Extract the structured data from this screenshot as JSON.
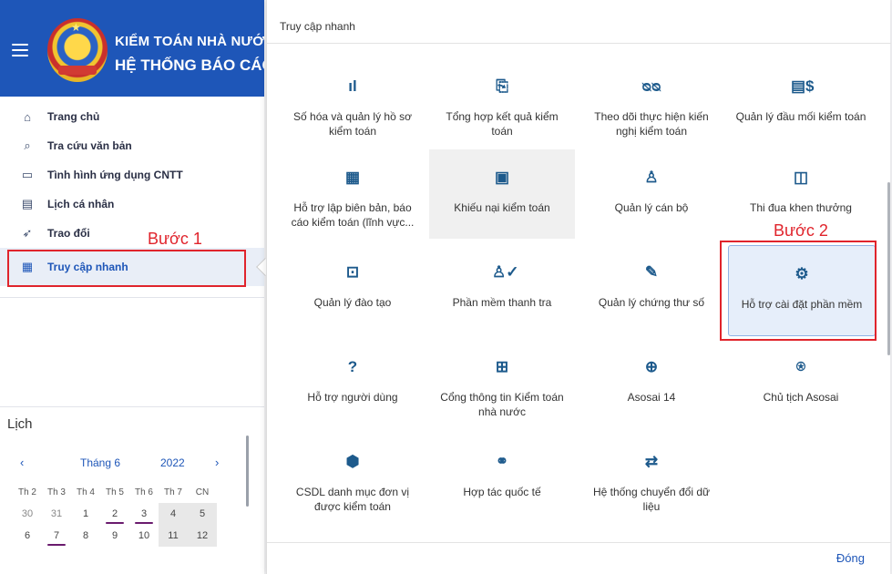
{
  "header": {
    "brand_line1": "KIỂM TOÁN NHÀ NƯỚC",
    "brand_line2": "HỆ THỐNG BÁO CÁO",
    "menu_icon": "hamburger-icon",
    "logo": "seal-logo"
  },
  "sidebar": {
    "items": [
      {
        "label": "Trang chủ",
        "icon": "home-icon"
      },
      {
        "label": "Tra cứu văn bản",
        "icon": "document-search-icon"
      },
      {
        "label": "Tình hình ứng dụng CNTT",
        "icon": "monitor-icon"
      },
      {
        "label": "Lịch cá nhân",
        "icon": "calendar-icon"
      },
      {
        "label": "Trao đổi",
        "icon": "send-icon"
      },
      {
        "label": "Truy cập nhanh",
        "icon": "quick-access-icon"
      }
    ],
    "annotation": "Bước 1"
  },
  "calendar": {
    "title": "Lịch",
    "month": "Tháng 6",
    "year": "2022",
    "weekdays": [
      "Th 2",
      "Th 3",
      "Th 4",
      "Th 5",
      "Th 6",
      "Th 7",
      "CN"
    ],
    "rows": [
      [
        "30",
        "31",
        "1",
        "2",
        "3",
        "4",
        "5"
      ],
      [
        "6",
        "7",
        "8",
        "9",
        "10",
        "11",
        "12"
      ]
    ]
  },
  "panel": {
    "title": "Truy cập nhanh",
    "close_label": "Đóng",
    "annotation": "Bước 2",
    "tiles": [
      {
        "label": "Số hóa và quản lý hồ sơ kiểm toán",
        "icon": "bar-chart-icon",
        "glyph": "ıl"
      },
      {
        "label": "Tổng hợp kết quả kiểm toán",
        "icon": "report-money-icon",
        "glyph": "⎘"
      },
      {
        "label": "Theo dõi thực hiện kiến nghị kiểm toán",
        "icon": "binoculars-icon",
        "glyph": "ᴓᴓ"
      },
      {
        "label": "Quản lý đầu mối kiểm toán",
        "icon": "building-money-icon",
        "glyph": "▤$"
      },
      {
        "label": "Hỗ trợ lập biên bản, báo cáo kiểm toán (lĩnh vực...",
        "icon": "document-chart-icon",
        "glyph": "▦"
      },
      {
        "label": "Khiếu nại kiểm toán",
        "icon": "complaint-icon",
        "glyph": "▣"
      },
      {
        "label": "Quản lý cán bộ",
        "icon": "user-icon",
        "glyph": "♙"
      },
      {
        "label": "Thi đua khen thưởng",
        "icon": "award-icon",
        "glyph": "◫"
      },
      {
        "label": "Quản lý đào tạo",
        "icon": "training-board-icon",
        "glyph": "⊡"
      },
      {
        "label": "Phần mềm thanh tra",
        "icon": "user-check-icon",
        "glyph": "♙✓"
      },
      {
        "label": "Quản lý chứng thư số",
        "icon": "signature-icon",
        "glyph": "✎"
      },
      {
        "label": "Hỗ trợ cài đặt phần mềm",
        "icon": "gear-icon",
        "glyph": "⚙"
      },
      {
        "label": "Hỗ trợ người dùng",
        "icon": "help-icon",
        "glyph": "?"
      },
      {
        "label": "Cổng thông tin Kiểm toán nhà nước",
        "icon": "portal-icon",
        "glyph": "⊞"
      },
      {
        "label": "Asosai 14",
        "icon": "globe-calendar-icon",
        "glyph": "⊕"
      },
      {
        "label": "Chủ tịch Asosai",
        "icon": "chairman-icon",
        "glyph": "⍟"
      },
      {
        "label": "CSDL danh mục đơn vị được kiểm toán",
        "icon": "box-icon",
        "glyph": "⬢"
      },
      {
        "label": "Hợp tác quốc tế",
        "icon": "handshake-icon",
        "glyph": "⚭"
      },
      {
        "label": "Hệ thống chuyển đổi dữ liệu",
        "icon": "convert-icon",
        "glyph": "⇄"
      }
    ]
  }
}
